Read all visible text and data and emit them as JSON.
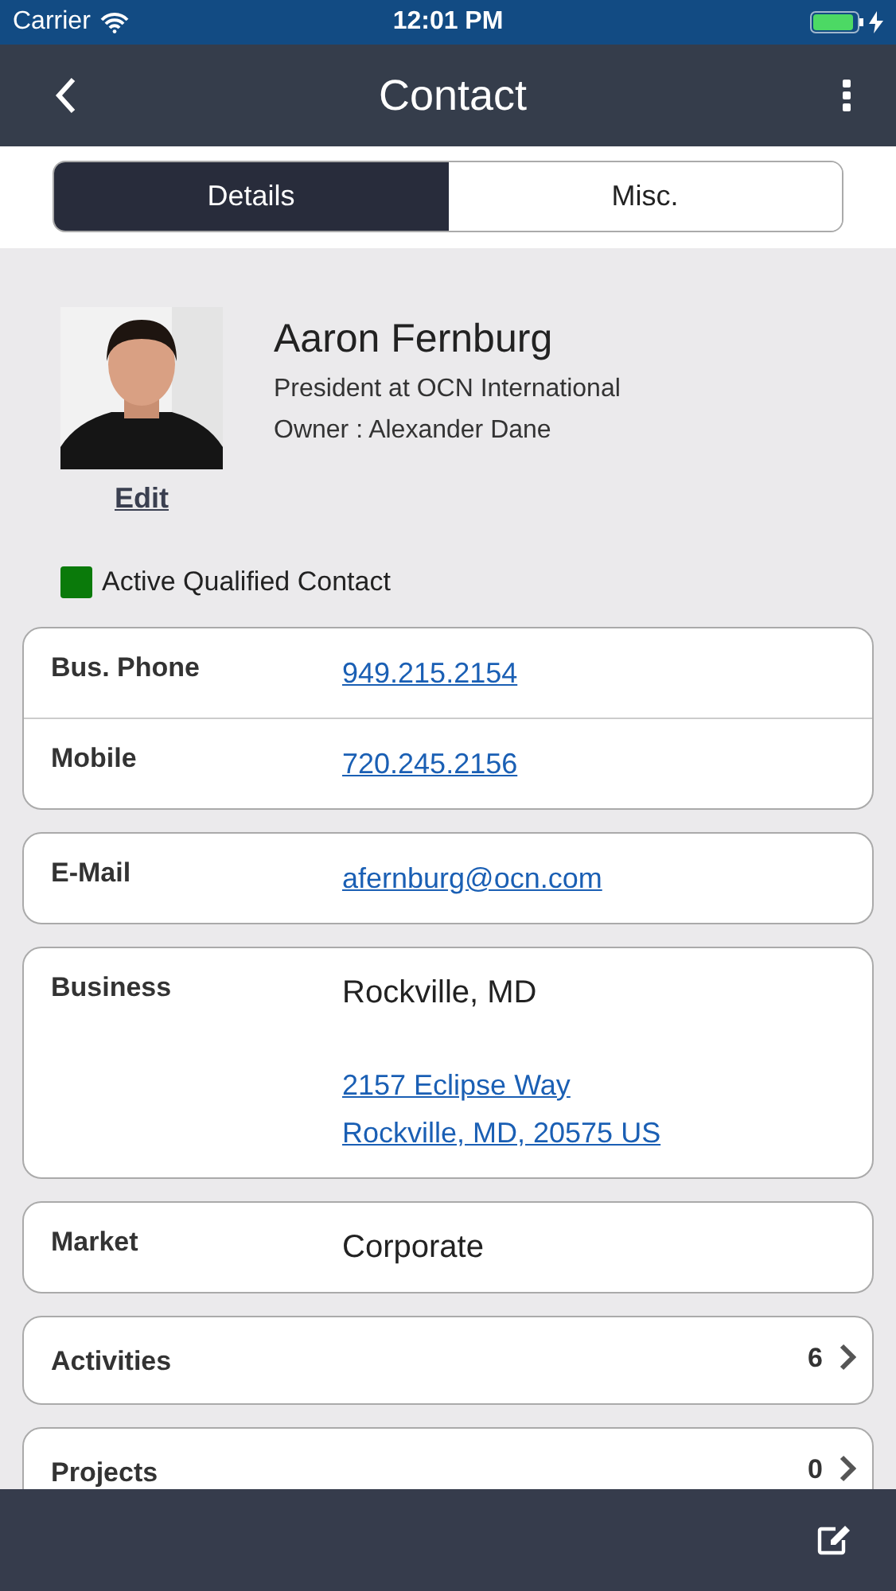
{
  "status_bar": {
    "carrier": "Carrier",
    "time": "12:01 PM",
    "charging": true
  },
  "nav": {
    "title": "Contact"
  },
  "tabs": [
    {
      "label": "Details",
      "selected": true
    },
    {
      "label": "Misc.",
      "selected": false
    }
  ],
  "contact": {
    "edit": "Edit",
    "name": "Aaron Fernburg",
    "title": "President at OCN International",
    "owner": "Owner : Alexander Dane"
  },
  "status": {
    "label": "Active Qualified Contact",
    "color": "#0a7a0a"
  },
  "sections": [
    {
      "kind": "fields",
      "rows": [
        {
          "label": "Bus. Phone",
          "values": [
            {
              "text": "949.215.2154",
              "kind": "link"
            }
          ]
        },
        {
          "label": "Mobile",
          "values": [
            {
              "text": "720.245.2156",
              "kind": "link"
            }
          ]
        }
      ]
    },
    {
      "kind": "fields",
      "rows": [
        {
          "label": "E-Mail",
          "values": [
            {
              "text": "afernburg@ocn.com",
              "kind": "link"
            }
          ]
        }
      ]
    },
    {
      "kind": "fields",
      "rows": [
        {
          "label": "Business",
          "values": [
            {
              "text": "Rockville, MD",
              "kind": "plain"
            },
            {
              "text": "2157 Eclipse Way",
              "kind": "link"
            },
            {
              "text": "Rockville, MD, 20575 US",
              "kind": "link"
            }
          ]
        }
      ]
    },
    {
      "kind": "fields",
      "rows": [
        {
          "label": "Market",
          "values": [
            {
              "text": "Corporate",
              "kind": "plain"
            }
          ]
        }
      ]
    },
    {
      "kind": "nav",
      "label": "Activities",
      "count": "6"
    },
    {
      "kind": "nav",
      "label": "Projects",
      "count": "0"
    }
  ]
}
